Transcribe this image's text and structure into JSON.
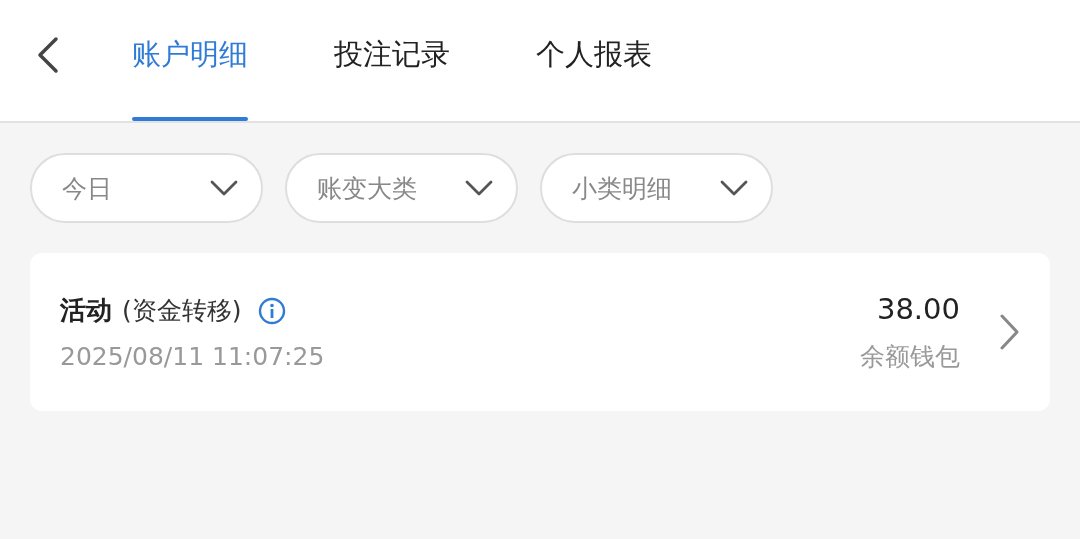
{
  "tabs": [
    {
      "label": "账户明细",
      "selected": true
    },
    {
      "label": "投注记录",
      "selected": false
    },
    {
      "label": "个人报表",
      "selected": false
    }
  ],
  "filters": [
    {
      "label": "今日"
    },
    {
      "label": "账变大类"
    },
    {
      "label": "小类明细"
    }
  ],
  "records": [
    {
      "category": "活动",
      "subcategory": "(资金转移)",
      "time": "2025/08/11 11:07:25",
      "amount": "38.00",
      "wallet": "余额钱包"
    }
  ]
}
